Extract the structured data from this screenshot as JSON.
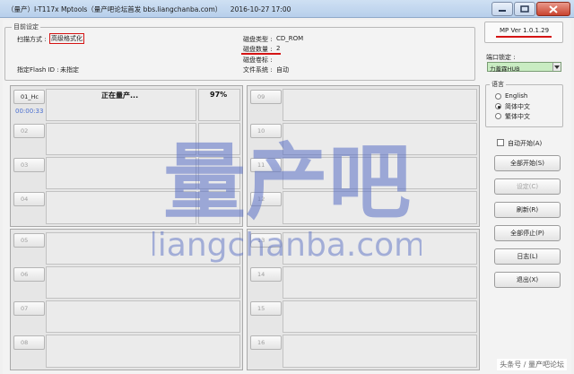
{
  "window": {
    "title": "（量产）I-T117x Mptools（量产吧论坛首发 bbs.liangchanba.com）",
    "timestamp": "2016-10-27 17:00"
  },
  "settings": {
    "legend": "目前设定",
    "scan_label": "扫描方式 :",
    "scan_value": "高级格式化",
    "flash_label": "指定Flash ID :",
    "flash_value": "未指定",
    "disk_type_label": "磁盘类型 :",
    "disk_type_value": "CD_ROM",
    "disk_count_label": "磁盘数量 :",
    "disk_count_value": "2",
    "disk_label_label": "磁盘卷标 :",
    "disk_label_value": "",
    "fs_label": "文件系统 :",
    "fs_value": "自动"
  },
  "version": "MP Ver 1.0.1.29",
  "port_lock": {
    "label": "端口锁定 :",
    "selected": "力蓋霖HUB"
  },
  "language": {
    "legend": "语言",
    "options": [
      {
        "label": "English",
        "checked": false
      },
      {
        "label": "简体中文",
        "checked": true
      },
      {
        "label": "繁体中文",
        "checked": false
      }
    ]
  },
  "auto_start": {
    "label": "自动开始(A)",
    "checked": false
  },
  "buttons": {
    "start_all": "全部开始(S)",
    "settings": "设定(C)",
    "refresh": "刷新(R)",
    "stop_all": "全部停止(P)",
    "log": "日志(L)",
    "exit": "退出(X)"
  },
  "ports": {
    "p01": {
      "label": "01_Hc",
      "status": "正在量产...",
      "progress": "97%",
      "time": "00:00:33"
    },
    "others": [
      "02",
      "03",
      "04",
      "05",
      "06",
      "07",
      "08",
      "09",
      "10",
      "11",
      "12",
      "13",
      "14",
      "15",
      "16"
    ]
  },
  "watermark": {
    "main": "量产吧",
    "sub": "liangchanba.com"
  },
  "footer": "头条号 / 量产吧论坛",
  "colors": {
    "accent_red": "#d51414",
    "watermark_blue": "#5a6fc4",
    "time_blue": "#4a6fd0"
  }
}
